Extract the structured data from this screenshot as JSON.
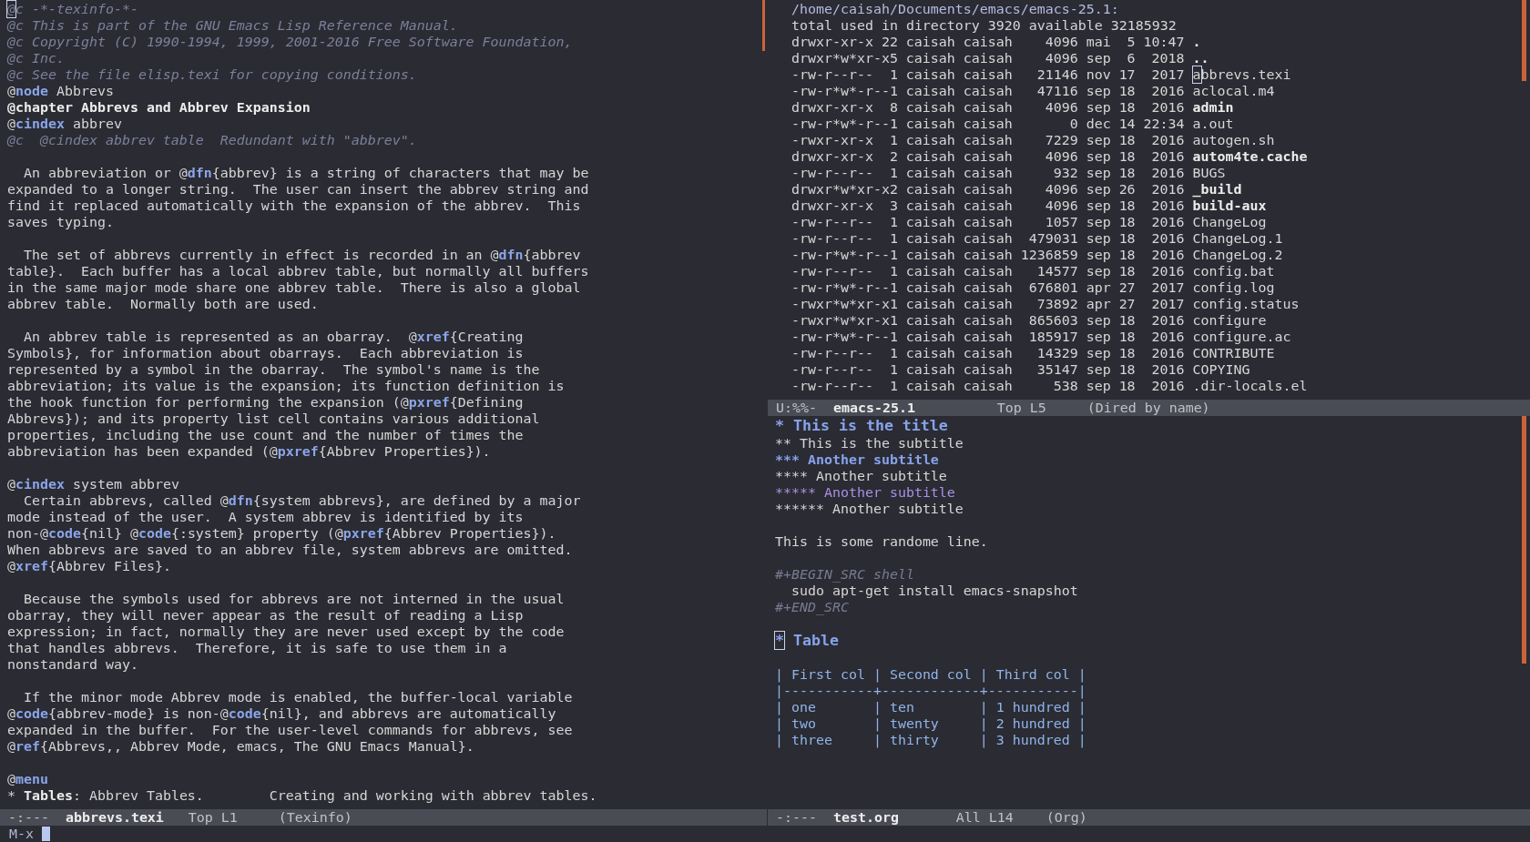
{
  "texinfo_window": {
    "paragraphs": [
      {
        "lines": [
          {
            "kind": "comment",
            "text": "@c -*-texinfo-*-",
            "cursor": true
          },
          {
            "kind": "comment",
            "text": "@c This is part of the GNU Emacs Lisp Reference Manual."
          },
          {
            "kind": "comment",
            "text": "@c Copyright (C) 1990-1994, 1999, 2001-2016 Free Software Foundation,"
          },
          {
            "kind": "comment",
            "text": "@c Inc."
          },
          {
            "kind": "comment",
            "text": "@c See the file elisp.texi for copying conditions."
          },
          {
            "parts": [
              {
                "kind": "plain",
                "text": "@"
              },
              {
                "kind": "keyword",
                "text": "node"
              },
              {
                "kind": "plain",
                "text": " Abbrevs"
              }
            ]
          },
          {
            "kind": "strong",
            "text": "@chapter Abbrevs and Abbrev Expansion"
          },
          {
            "parts": [
              {
                "kind": "plain",
                "text": "@"
              },
              {
                "kind": "keyword",
                "text": "cindex"
              },
              {
                "kind": "plain",
                "text": " abbrev"
              }
            ]
          },
          {
            "kind": "comment",
            "text": "@c  @cindex abbrev table  Redundant with \"abbrev\"."
          }
        ]
      },
      {
        "lines": [
          {
            "parts": [
              {
                "kind": "plain",
                "text": "  An abbreviation or @"
              },
              {
                "kind": "keyword",
                "text": "dfn"
              },
              {
                "kind": "plain",
                "text": "{abbrev} is a string of characters that may be"
              }
            ]
          },
          {
            "kind": "plain",
            "text": "expanded to a longer string.  The user can insert the abbrev string and"
          },
          {
            "kind": "plain",
            "text": "find it replaced automatically with the expansion of the abbrev.  This"
          },
          {
            "kind": "plain",
            "text": "saves typing."
          }
        ]
      },
      {
        "lines": [
          {
            "parts": [
              {
                "kind": "plain",
                "text": "  The set of abbrevs currently in effect is recorded in an @"
              },
              {
                "kind": "keyword",
                "text": "dfn"
              },
              {
                "kind": "plain",
                "text": "{abbrev"
              }
            ]
          },
          {
            "kind": "plain",
            "text": "table}.  Each buffer has a local abbrev table, but normally all buffers"
          },
          {
            "kind": "plain",
            "text": "in the same major mode share one abbrev table.  There is also a global"
          },
          {
            "kind": "plain",
            "text": "abbrev table.  Normally both are used."
          }
        ]
      },
      {
        "lines": [
          {
            "parts": [
              {
                "kind": "plain",
                "text": "  An abbrev table is represented as an obarray.  @"
              },
              {
                "kind": "keyword",
                "text": "xref"
              },
              {
                "kind": "plain",
                "text": "{Creating"
              }
            ]
          },
          {
            "kind": "plain",
            "text": "Symbols}, for information about obarrays.  Each abbreviation is"
          },
          {
            "kind": "plain",
            "text": "represented by a symbol in the obarray.  The symbol's name is the"
          },
          {
            "kind": "plain",
            "text": "abbreviation; its value is the expansion; its function definition is"
          },
          {
            "parts": [
              {
                "kind": "plain",
                "text": "the hook function for performing the expansion (@"
              },
              {
                "kind": "keyword",
                "text": "pxref"
              },
              {
                "kind": "plain",
                "text": "{Defining"
              }
            ]
          },
          {
            "kind": "plain",
            "text": "Abbrevs}); and its property list cell contains various additional"
          },
          {
            "kind": "plain",
            "text": "properties, including the use count and the number of times the"
          },
          {
            "parts": [
              {
                "kind": "plain",
                "text": "abbreviation has been expanded (@"
              },
              {
                "kind": "keyword",
                "text": "pxref"
              },
              {
                "kind": "plain",
                "text": "{Abbrev Properties})."
              }
            ]
          }
        ]
      },
      {
        "lines": [
          {
            "parts": [
              {
                "kind": "plain",
                "text": "@"
              },
              {
                "kind": "keyword",
                "text": "cindex"
              },
              {
                "kind": "plain",
                "text": " system abbrev"
              }
            ]
          },
          {
            "parts": [
              {
                "kind": "plain",
                "text": "  Certain abbrevs, called @"
              },
              {
                "kind": "keyword",
                "text": "dfn"
              },
              {
                "kind": "plain",
                "text": "{system abbrevs}, are defined by a major"
              }
            ]
          },
          {
            "kind": "plain",
            "text": "mode instead of the user.  A system abbrev is identified by its"
          },
          {
            "parts": [
              {
                "kind": "plain",
                "text": "non-@"
              },
              {
                "kind": "keyword",
                "text": "code"
              },
              {
                "kind": "plain",
                "text": "{nil} @"
              },
              {
                "kind": "keyword",
                "text": "code"
              },
              {
                "kind": "plain",
                "text": "{:system} property (@"
              },
              {
                "kind": "keyword",
                "text": "pxref"
              },
              {
                "kind": "plain",
                "text": "{Abbrev Properties})."
              }
            ]
          },
          {
            "kind": "plain",
            "text": "When abbrevs are saved to an abbrev file, system abbrevs are omitted."
          },
          {
            "parts": [
              {
                "kind": "plain",
                "text": "@"
              },
              {
                "kind": "keyword",
                "text": "xref"
              },
              {
                "kind": "plain",
                "text": "{Abbrev Files}."
              }
            ]
          }
        ]
      },
      {
        "lines": [
          {
            "kind": "plain",
            "text": "  Because the symbols used for abbrevs are not interned in the usual"
          },
          {
            "kind": "plain",
            "text": "obarray, they will never appear as the result of reading a Lisp"
          },
          {
            "kind": "plain",
            "text": "expression; in fact, normally they are never used except by the code"
          },
          {
            "kind": "plain",
            "text": "that handles abbrevs.  Therefore, it is safe to use them in a"
          },
          {
            "kind": "plain",
            "text": "nonstandard way."
          }
        ]
      },
      {
        "lines": [
          {
            "kind": "plain",
            "text": "  If the minor mode Abbrev mode is enabled, the buffer-local variable"
          },
          {
            "parts": [
              {
                "kind": "plain",
                "text": "@"
              },
              {
                "kind": "keyword",
                "text": "code"
              },
              {
                "kind": "plain",
                "text": "{abbrev-mode} is non-@"
              },
              {
                "kind": "keyword",
                "text": "code"
              },
              {
                "kind": "plain",
                "text": "{nil}, and abbrevs are automatically"
              }
            ]
          },
          {
            "kind": "plain",
            "text": "expanded in the buffer.  For the user-level commands for abbrevs, see"
          },
          {
            "parts": [
              {
                "kind": "plain",
                "text": "@"
              },
              {
                "kind": "keyword",
                "text": "ref"
              },
              {
                "kind": "plain",
                "text": "{Abbrevs,, Abbrev Mode, emacs, The GNU Emacs Manual}."
              }
            ]
          }
        ]
      },
      {
        "lines": [
          {
            "parts": [
              {
                "kind": "plain",
                "text": "@"
              },
              {
                "kind": "keyword",
                "text": "menu"
              }
            ]
          },
          {
            "parts": [
              {
                "kind": "plain",
                "text": "* "
              },
              {
                "kind": "strong",
                "text": "Tables"
              },
              {
                "kind": "plain",
                "text": ": Abbrev Tables.        Creating and working with abbrev tables."
              }
            ]
          }
        ]
      }
    ],
    "mode_line": {
      "status": "-:---",
      "buffer_name": "abbrevs.texi",
      "position": "Top L1",
      "mode": "(Texinfo)"
    }
  },
  "dired_window": {
    "header": "/home/caisah/Documents/emacs/emacs-25.1:",
    "summary": "total used in directory 3920 available 32185932",
    "entries": [
      {
        "permissions": "drwxr-xr-x",
        "links": "22",
        "owner": "caisah",
        "group": "caisah",
        "size": "4096",
        "date": "mai  5 10:47",
        "name": ".",
        "kind": "directory",
        "cursor": false
      },
      {
        "permissions": "drwxr*w*xr-x",
        "links": "5",
        "owner": "caisah",
        "group": "caisah",
        "size": "4096",
        "date": "sep  6  2018",
        "name": "..",
        "kind": "directory",
        "cursor": false
      },
      {
        "permissions": "-rw-r--r--",
        "links": "1",
        "owner": "caisah",
        "group": "caisah",
        "size": "21146",
        "date": "nov 17  2017",
        "name": "abbrevs.texi",
        "kind": "file",
        "cursor": true
      },
      {
        "permissions": "-rw-r*w*-r--",
        "links": "1",
        "owner": "caisah",
        "group": "caisah",
        "size": "47116",
        "date": "sep 18  2016",
        "name": "aclocal.m4",
        "kind": "file",
        "cursor": false
      },
      {
        "permissions": "drwxr-xr-x",
        "links": "8",
        "owner": "caisah",
        "group": "caisah",
        "size": "4096",
        "date": "sep 18  2016",
        "name": "admin",
        "kind": "directory",
        "cursor": false
      },
      {
        "permissions": "-rw-r*w*-r--",
        "links": "1",
        "owner": "caisah",
        "group": "caisah",
        "size": "0",
        "date": "dec 14 22:34",
        "name": "a.out",
        "kind": "file",
        "cursor": false
      },
      {
        "permissions": "-rwxr-xr-x",
        "links": "1",
        "owner": "caisah",
        "group": "caisah",
        "size": "7229",
        "date": "sep 18  2016",
        "name": "autogen.sh",
        "kind": "file",
        "cursor": false
      },
      {
        "permissions": "drwxr-xr-x",
        "links": "2",
        "owner": "caisah",
        "group": "caisah",
        "size": "4096",
        "date": "sep 18  2016",
        "name": "autom4te.cache",
        "kind": "directory",
        "cursor": false
      },
      {
        "permissions": "-rw-r--r--",
        "links": "1",
        "owner": "caisah",
        "group": "caisah",
        "size": "932",
        "date": "sep 18  2016",
        "name": "BUGS",
        "kind": "file",
        "cursor": false
      },
      {
        "permissions": "drwxr*w*xr-x",
        "links": "2",
        "owner": "caisah",
        "group": "caisah",
        "size": "4096",
        "date": "sep 26  2016",
        "name": "_build",
        "kind": "directory",
        "cursor": false
      },
      {
        "permissions": "drwxr-xr-x",
        "links": "3",
        "owner": "caisah",
        "group": "caisah",
        "size": "4096",
        "date": "sep 18  2016",
        "name": "build-aux",
        "kind": "directory",
        "cursor": false
      },
      {
        "permissions": "-rw-r--r--",
        "links": "1",
        "owner": "caisah",
        "group": "caisah",
        "size": "1057",
        "date": "sep 18  2016",
        "name": "ChangeLog",
        "kind": "file",
        "cursor": false
      },
      {
        "permissions": "-rw-r--r--",
        "links": "1",
        "owner": "caisah",
        "group": "caisah",
        "size": "479031",
        "date": "sep 18  2016",
        "name": "ChangeLog.1",
        "kind": "file",
        "cursor": false
      },
      {
        "permissions": "-rw-r*w*-r--",
        "links": "1",
        "owner": "caisah",
        "group": "caisah",
        "size": "1236859",
        "date": "sep 18  2016",
        "name": "ChangeLog.2",
        "kind": "file",
        "cursor": false
      },
      {
        "permissions": "-rw-r--r--",
        "links": "1",
        "owner": "caisah",
        "group": "caisah",
        "size": "14577",
        "date": "sep 18  2016",
        "name": "config.bat",
        "kind": "file",
        "cursor": false
      },
      {
        "permissions": "-rw-r*w*-r--",
        "links": "1",
        "owner": "caisah",
        "group": "caisah",
        "size": "676801",
        "date": "apr 27  2017",
        "name": "config.log",
        "kind": "file",
        "cursor": false
      },
      {
        "permissions": "-rwxr*w*xr-x",
        "links": "1",
        "owner": "caisah",
        "group": "caisah",
        "size": "73892",
        "date": "apr 27  2017",
        "name": "config.status",
        "kind": "file",
        "cursor": false
      },
      {
        "permissions": "-rwxr*w*xr-x",
        "links": "1",
        "owner": "caisah",
        "group": "caisah",
        "size": "865603",
        "date": "sep 18  2016",
        "name": "configure",
        "kind": "file",
        "cursor": false
      },
      {
        "permissions": "-rw-r*w*-r--",
        "links": "1",
        "owner": "caisah",
        "group": "caisah",
        "size": "185917",
        "date": "sep 18  2016",
        "name": "configure.ac",
        "kind": "file",
        "cursor": false
      },
      {
        "permissions": "-rw-r--r--",
        "links": "1",
        "owner": "caisah",
        "group": "caisah",
        "size": "14329",
        "date": "sep 18  2016",
        "name": "CONTRIBUTE",
        "kind": "file",
        "cursor": false
      },
      {
        "permissions": "-rw-r--r--",
        "links": "1",
        "owner": "caisah",
        "group": "caisah",
        "size": "35147",
        "date": "sep 18  2016",
        "name": "COPYING",
        "kind": "file",
        "cursor": false
      },
      {
        "permissions": "-rw-r--r--",
        "links": "1",
        "owner": "caisah",
        "group": "caisah",
        "size": "538",
        "date": "sep 18  2016",
        "name": ".dir-locals.el",
        "kind": "file",
        "cursor": false
      }
    ],
    "mode_line": {
      "status": "U:%%-",
      "buffer_name": "emacs-25.1",
      "position": "Top L5",
      "mode": "(Dired by name)"
    }
  },
  "org_window": {
    "outline": [
      {
        "title": "* This is the title",
        "cursor": false,
        "children": [
          {
            "title": "** This is the subtitle",
            "cursor": false,
            "children": [
              {
                "title": "*** Another subtitle",
                "cursor": false,
                "children": [
                  {
                    "title": "**** Another subtitle",
                    "cursor": false,
                    "children": [
                      {
                        "title": "***** Another subtitle",
                        "cursor": false,
                        "children": [
                          {
                            "title": "****** Another subtitle",
                            "cursor": false,
                            "body": [
                              {
                                "kind": "text",
                                "lines": [
                                  "This is some randome line."
                                ]
                              },
                              {
                                "kind": "src",
                                "begin": "#+BEGIN_SRC shell",
                                "code": [
                                  "  sudo apt-get install emacs-snapshot"
                                ],
                                "end": "#+END_SRC"
                              }
                            ]
                          }
                        ]
                      }
                    ]
                  }
                ]
              }
            ]
          }
        ]
      },
      {
        "title": "* Table",
        "cursor": true,
        "body": [
          {
            "kind": "table",
            "lines": [
              "| First col | Second col | Third col |",
              "|-----------+------------+-----------|",
              "| one       | ten        | 1 hundred |",
              "| two       | twenty     | 2 hundred |",
              "| three     | thirty     | 3 hundred |"
            ]
          }
        ]
      }
    ],
    "mode_line": {
      "status": "-:---",
      "buffer_name": "test.org",
      "position": "All L14",
      "mode": "(Org)"
    }
  },
  "minibuffer": {
    "prompt": "M-x",
    "cursor": true
  }
}
